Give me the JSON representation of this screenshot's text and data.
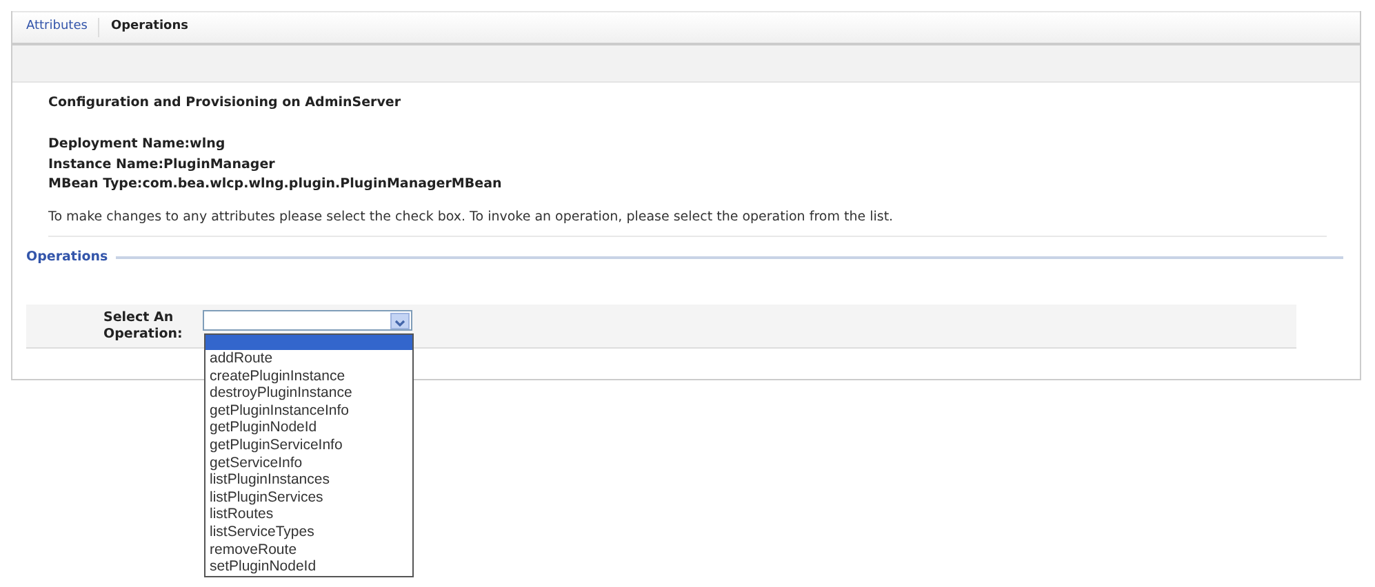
{
  "tabs": [
    {
      "label": "Attributes",
      "selected": false
    },
    {
      "label": "Operations",
      "selected": true
    }
  ],
  "heading": "Configuration and Provisioning on AdminServer",
  "details": [
    "Deployment Name:wlng",
    "Instance Name:PluginManager",
    "MBean Type:com.bea.wlcp.wlng.plugin.PluginManagerMBean"
  ],
  "instructions": "To make changes to any attributes please select the check box. To invoke an operation, please select the operation from the list.",
  "section_title": "Operations",
  "operation_select": {
    "label": "Select An Operation:",
    "expanded": true,
    "blank_option_selected": true,
    "options": [
      {
        "label": "addRoute",
        "selected": false
      },
      {
        "label": "createPluginInstance",
        "selected": false
      },
      {
        "label": "destroyPluginInstance",
        "selected": false
      },
      {
        "label": "getPluginInstanceInfo",
        "selected": false
      },
      {
        "label": "getPluginNodeId",
        "selected": false
      },
      {
        "label": "getPluginServiceInfo",
        "selected": false
      },
      {
        "label": "getServiceInfo",
        "selected": false
      },
      {
        "label": "listPluginInstances",
        "selected": false
      },
      {
        "label": "listPluginServices",
        "selected": false
      },
      {
        "label": "listRoutes",
        "selected": false
      },
      {
        "label": "listServiceTypes",
        "selected": false
      },
      {
        "label": "removeRoute",
        "selected": false
      },
      {
        "label": "setPluginNodeId",
        "selected": false
      }
    ]
  }
}
